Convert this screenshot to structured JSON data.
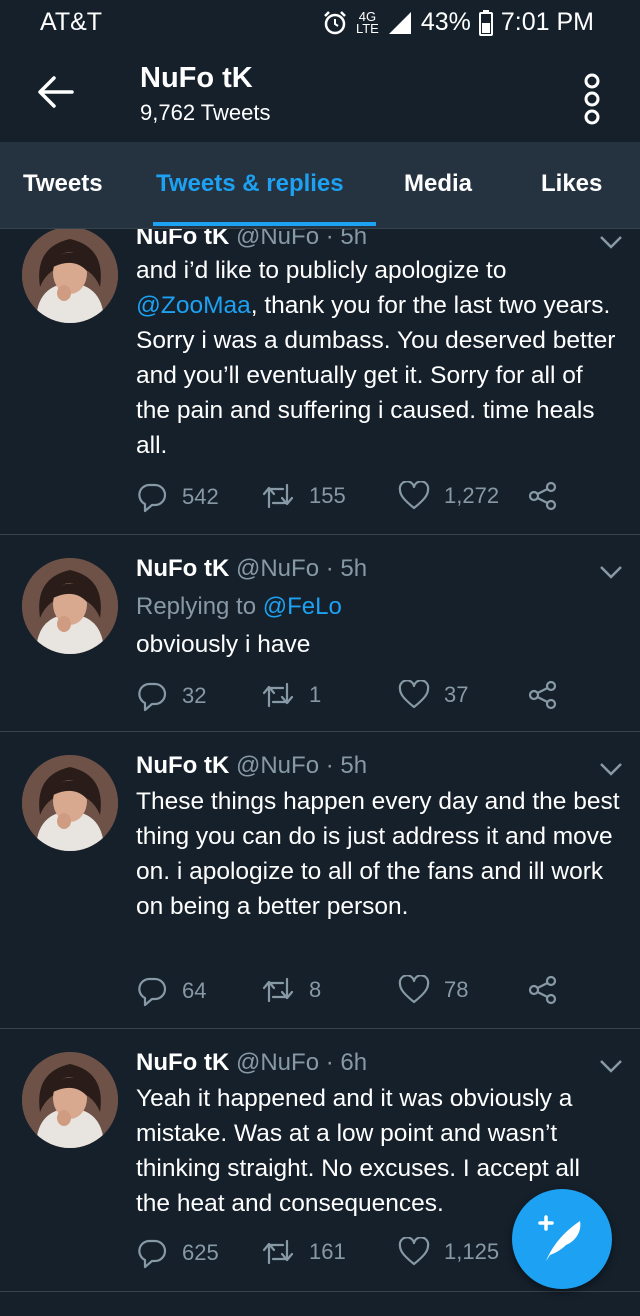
{
  "status_bar": {
    "carrier": "AT&T",
    "network": "4G LTE",
    "battery": "43%",
    "time": "7:01 PM"
  },
  "header": {
    "profile_name": "NuFo tK",
    "tweet_count": "9,762 Tweets"
  },
  "tabs": [
    {
      "label": "Tweets",
      "active": false
    },
    {
      "label": "Tweets & replies",
      "active": true
    },
    {
      "label": "Media",
      "active": false
    },
    {
      "label": "Likes",
      "active": false
    }
  ],
  "tweets": [
    {
      "name": "NuFo tK",
      "handle": "@NuFo",
      "time": "5h",
      "text_pre": "and i’d like to publicly apologize to ",
      "mention": "@ZooMaa",
      "text_post": ", thank you for the last two years. Sorry i was a dumbass. You deserved better and you’ll eventually get it. Sorry for all of the pain and suffering i caused. time heals all.",
      "replies": "542",
      "retweets": "155",
      "likes": "1,272"
    },
    {
      "name": "NuFo tK",
      "handle": "@NuFo",
      "time": "5h",
      "replying_label": "Replying to ",
      "replying_to": "@FeLo",
      "text": "obviously i have",
      "replies": "32",
      "retweets": "1",
      "likes": "37"
    },
    {
      "name": "NuFo tK",
      "handle": "@NuFo",
      "time": "5h",
      "text": "These things happen every day and the best thing you can do is just address it and move on. i apologize to all of the fans and ill work on being a better person.",
      "replies": "64",
      "retweets": "8",
      "likes": "78"
    },
    {
      "name": "NuFo tK",
      "handle": "@NuFo",
      "time": "6h",
      "text": "Yeah it happened and it was obviously a mistake. Was at a low point and wasn’t thinking straight. No excuses. I accept all the heat and consequences.",
      "replies": "625",
      "retweets": "161",
      "likes": "1,125"
    }
  ],
  "colors": {
    "background": "#15202b",
    "tab_bar": "#253341",
    "accent": "#1da1f2",
    "muted": "#8899a6",
    "divider": "#38444d"
  },
  "icons": [
    "alarm-icon",
    "signal-icon",
    "battery-icon",
    "back-arrow-icon",
    "more-vertical-icon",
    "caret-down-icon",
    "reply-icon",
    "retweet-icon",
    "like-icon",
    "share-icon",
    "compose-tweet-icon"
  ]
}
